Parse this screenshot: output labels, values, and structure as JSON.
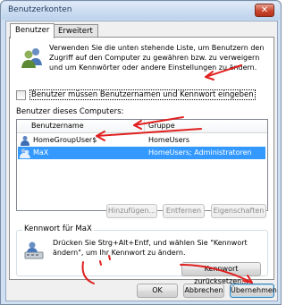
{
  "window": {
    "title": "Benutzerkonten",
    "close_glyph": "✕"
  },
  "tabs": [
    {
      "label": "Benutzer",
      "active": true
    },
    {
      "label": "Erweitert",
      "active": false
    }
  ],
  "intro_text": "Verwenden Sie die unten stehende Liste, um Benutzern den Zugriff auf den Computer zu gewähren bzw. zu verweigern und um Kennwörter oder andere Einstellungen zu ändern.",
  "require_password": {
    "label": "Benutzer müssen Benutzernamen und Kennwort eingeben",
    "checked": false
  },
  "users_section_label": "Benutzer dieses Computers:",
  "user_list": {
    "columns": [
      "Benutzername",
      "Gruppe"
    ],
    "rows": [
      {
        "name": "HomeGroupUser$",
        "group": "HomeUsers",
        "selected": false,
        "icon": "user-icon"
      },
      {
        "name": "MaX",
        "group": "HomeUsers; Administratoren",
        "selected": true,
        "icon": "user-icon"
      }
    ]
  },
  "user_buttons": {
    "add": "Hinzufügen...",
    "remove": "Entfernen",
    "properties": "Eigenschaften"
  },
  "password_group": {
    "title": "Kennwort für MaX",
    "text": "Drücken Sie Strg+Alt+Entf, und wählen Sie \"Kennwort ändern\", um Ihr Kennwort zu ändern.",
    "reset_button": "Kennwort zurücksetzen..."
  },
  "dialog_buttons": {
    "ok": "OK",
    "cancel": "Abbrechen",
    "apply": "Übernehmen"
  },
  "colors": {
    "selection": "#3399ff",
    "annotation_red": "#e02020"
  }
}
